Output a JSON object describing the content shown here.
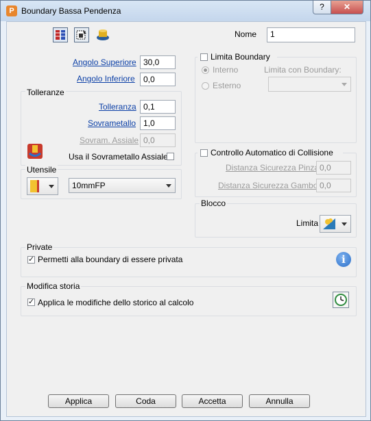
{
  "window": {
    "title": "Boundary Bassa Pendenza",
    "app_icon_letter": "P",
    "help_glyph": "?",
    "close_glyph": "✕"
  },
  "toolbar": {
    "icons": [
      "boundary-type-icon",
      "boundary-select-icon",
      "tool-shape-icon"
    ]
  },
  "name": {
    "label": "Nome",
    "value": "1"
  },
  "angles": {
    "upper_label": "Angolo Superiore",
    "upper_value": "30,0",
    "lower_label": "Angolo Inferiore",
    "lower_value": "0,0"
  },
  "tolerances": {
    "title": "Tolleranze",
    "tolerance_label": "Tolleranza",
    "tolerance_value": "0,1",
    "stock_label": "Sovrametallo",
    "stock_value": "1,0",
    "axial_label": "Sovram. Assiale",
    "axial_value": "0,0",
    "use_axial_label": "Usa il Sovrametallo Assiale",
    "use_axial_checked": false
  },
  "tool": {
    "title": "Utensile",
    "selected": "10mmFP"
  },
  "limit": {
    "checkbox_label": "Limita Boundary",
    "checked": false,
    "inside_label": "Interno",
    "outside_label": "Esterno",
    "limit_with_label": "Limita con Boundary:",
    "limit_with_value": ""
  },
  "collision": {
    "checkbox_label": "Controllo Automatico di Collisione",
    "checked": false,
    "holder_label": "Distanza Sicurezza Pinza",
    "holder_value": "0,0",
    "shank_label": "Distanza Sicurezza Gambo",
    "shank_value": "0,0"
  },
  "block": {
    "title": "Blocco",
    "limit_label": "Limita"
  },
  "private": {
    "title": "Private",
    "checkbox_label": "Permetti alla boundary di essere privata",
    "checked": true
  },
  "history": {
    "title": "Modifica storia",
    "checkbox_label": "Applica le modifiche dello storico al calcolo",
    "checked": true
  },
  "buttons": {
    "apply": "Applica",
    "queue": "Coda",
    "accept": "Accetta",
    "cancel": "Annulla"
  },
  "colors": {
    "accent_link": "#0b3fa6",
    "title_bar": "#c4d6ec",
    "close_button": "#c75050",
    "info_icon": "#2a6fc9"
  }
}
